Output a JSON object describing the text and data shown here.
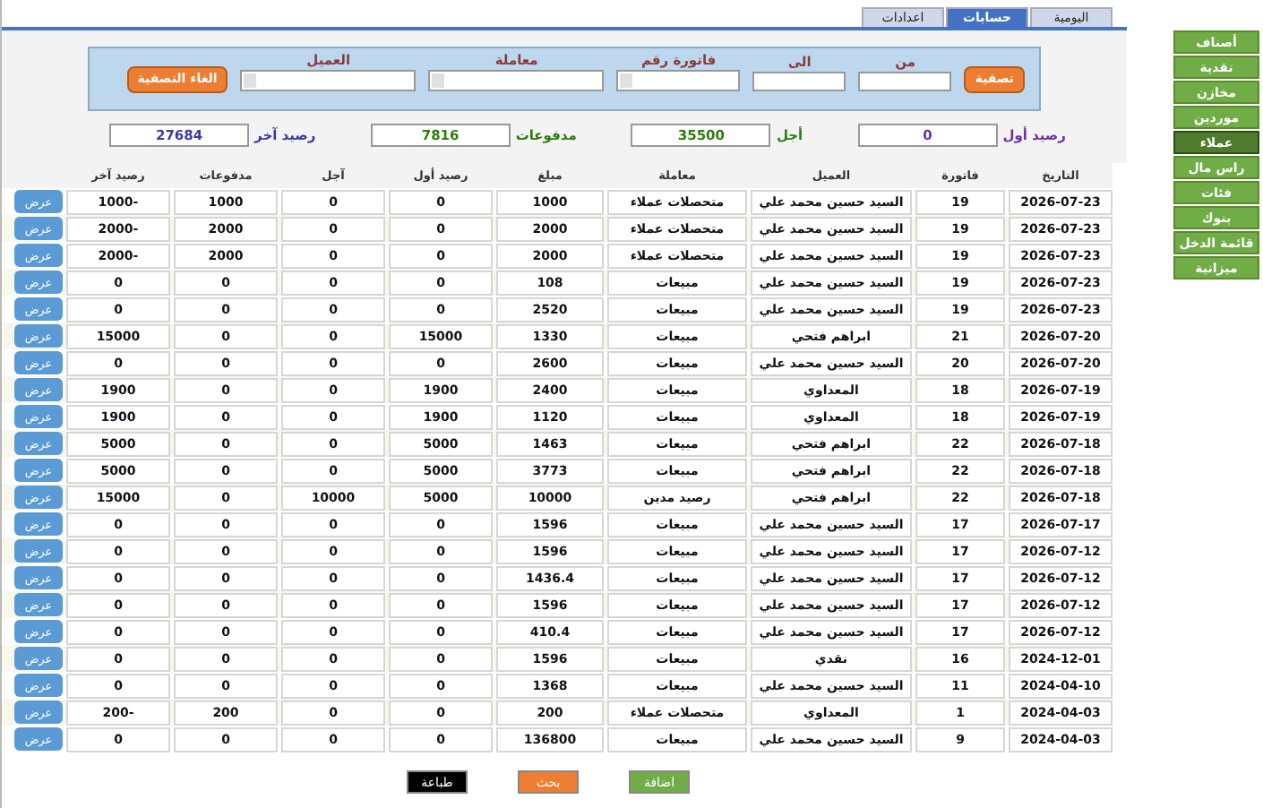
{
  "tabs": [
    {
      "label": "اليومية",
      "selected": false
    },
    {
      "label": "حسابات",
      "selected": true
    },
    {
      "label": "اعدادات",
      "selected": false
    }
  ],
  "sidebar": {
    "items": [
      {
        "label": "أصناف",
        "selected": false
      },
      {
        "label": "نقدية",
        "selected": false
      },
      {
        "label": "مخازن",
        "selected": false
      },
      {
        "label": "موردين",
        "selected": false
      },
      {
        "label": "عملاء",
        "selected": true
      },
      {
        "label": "راس مال",
        "selected": false
      },
      {
        "label": "فئات",
        "selected": false
      },
      {
        "label": "بنوك",
        "selected": false
      },
      {
        "label": "قائمة الدخل",
        "selected": false
      },
      {
        "label": "ميزانية",
        "selected": false
      }
    ]
  },
  "filter": {
    "apply_button": "تصفية",
    "from_label": "من",
    "to_label": "الى",
    "invoice_label": "فاتورة رقم",
    "type_label": "معاملة",
    "customer_label": "العميل",
    "clear_button": "الغاء التصفية"
  },
  "balances": [
    {
      "label": "رصيد أول",
      "value": "0",
      "color": "#7030a0"
    },
    {
      "label": "أجل",
      "value": "35500",
      "color": "#2e7d0f"
    },
    {
      "label": "مدفوعات",
      "value": "7816",
      "color": "#2e7d0f"
    },
    {
      "label": "رصيد آخر",
      "value": "27684",
      "color": "#3a3aa0"
    }
  ],
  "table": {
    "columns": [
      "التاريخ",
      "فاتورة",
      "العميل",
      "معاملة",
      "مبلغ",
      "رصيد أول",
      "آجل",
      "مدفوعات",
      "رصيد آخر"
    ],
    "rows": [
      {
        "cells": [
          "2026-07-23",
          "19",
          "السيد حسين محمد علي",
          "متحصلات عملاء",
          "1000",
          "0",
          "0",
          "1000",
          "-1000"
        ],
        "action": "عرض"
      },
      {
        "cells": [
          "2026-07-23",
          "19",
          "السيد حسين محمد علي",
          "متحصلات عملاء",
          "2000",
          "0",
          "0",
          "2000",
          "-2000"
        ],
        "action": "عرض"
      },
      {
        "cells": [
          "2026-07-23",
          "19",
          "السيد حسين محمد علي",
          "متحصلات عملاء",
          "2000",
          "0",
          "0",
          "2000",
          "-2000"
        ],
        "action": "عرض"
      },
      {
        "cells": [
          "2026-07-23",
          "19",
          "السيد حسين محمد علي",
          "مبيعات",
          "108",
          "0",
          "0",
          "0",
          "0"
        ],
        "action": "عرض"
      },
      {
        "cells": [
          "2026-07-23",
          "19",
          "السيد حسين محمد علي",
          "مبيعات",
          "2520",
          "0",
          "0",
          "0",
          "0"
        ],
        "action": "عرض"
      },
      {
        "cells": [
          "2026-07-20",
          "21",
          "ابراهم فتحي",
          "مبيعات",
          "1330",
          "15000",
          "0",
          "0",
          "15000"
        ],
        "action": "عرض"
      },
      {
        "cells": [
          "2026-07-20",
          "20",
          "السيد حسين محمد علي",
          "مبيعات",
          "2600",
          "0",
          "0",
          "0",
          "0"
        ],
        "action": "عرض"
      },
      {
        "cells": [
          "2026-07-19",
          "18",
          "المعداوي",
          "مبيعات",
          "2400",
          "1900",
          "0",
          "0",
          "1900"
        ],
        "action": "عرض"
      },
      {
        "cells": [
          "2026-07-19",
          "18",
          "المعداوي",
          "مبيعات",
          "1120",
          "1900",
          "0",
          "0",
          "1900"
        ],
        "action": "عرض"
      },
      {
        "cells": [
          "2026-07-18",
          "22",
          "ابراهم فتحي",
          "مبيعات",
          "1463",
          "5000",
          "0",
          "0",
          "5000"
        ],
        "action": "عرض"
      },
      {
        "cells": [
          "2026-07-18",
          "22",
          "ابراهم فتحي",
          "مبيعات",
          "3773",
          "5000",
          "0",
          "0",
          "5000"
        ],
        "action": "عرض"
      },
      {
        "cells": [
          "2026-07-18",
          "22",
          "ابراهم فتحي",
          "رصيد مدين",
          "10000",
          "5000",
          "10000",
          "0",
          "15000"
        ],
        "action": "عرض"
      },
      {
        "cells": [
          "2026-07-17",
          "17",
          "السيد حسين محمد علي",
          "مبيعات",
          "1596",
          "0",
          "0",
          "0",
          "0"
        ],
        "action": "عرض"
      },
      {
        "cells": [
          "2026-07-12",
          "17",
          "السيد حسين محمد علي",
          "مبيعات",
          "1596",
          "0",
          "0",
          "0",
          "0"
        ],
        "action": "عرض"
      },
      {
        "cells": [
          "2026-07-12",
          "17",
          "السيد حسين محمد علي",
          "مبيعات",
          "1436.4",
          "0",
          "0",
          "0",
          "0"
        ],
        "action": "عرض"
      },
      {
        "cells": [
          "2026-07-12",
          "17",
          "السيد حسين محمد علي",
          "مبيعات",
          "1596",
          "0",
          "0",
          "0",
          "0"
        ],
        "action": "عرض"
      },
      {
        "cells": [
          "2026-07-12",
          "17",
          "السيد حسين محمد علي",
          "مبيعات",
          "410.4",
          "0",
          "0",
          "0",
          "0"
        ],
        "action": "عرض"
      },
      {
        "cells": [
          "2024-12-01",
          "16",
          "نقدي",
          "مبيعات",
          "1596",
          "0",
          "0",
          "0",
          "0"
        ],
        "action": "عرض"
      },
      {
        "cells": [
          "2024-04-10",
          "11",
          "السيد حسين محمد علي",
          "مبيعات",
          "1368",
          "0",
          "0",
          "0",
          "0"
        ],
        "action": "عرض"
      },
      {
        "cells": [
          "2024-04-03",
          "1",
          "المعداوي",
          "متحصلات عملاء",
          "200",
          "0",
          "0",
          "200",
          "-200"
        ],
        "action": "عرض"
      },
      {
        "cells": [
          "2024-04-03",
          "9",
          "السيد حسين محمد علي",
          "مبيعات",
          "136800",
          "0",
          "0",
          "0",
          "0"
        ],
        "action": "عرض"
      }
    ]
  },
  "buttons": [
    {
      "label": "اضافة",
      "kind": "add"
    },
    {
      "label": "بحث",
      "kind": "search"
    },
    {
      "label": "طباعة",
      "kind": "print"
    }
  ]
}
